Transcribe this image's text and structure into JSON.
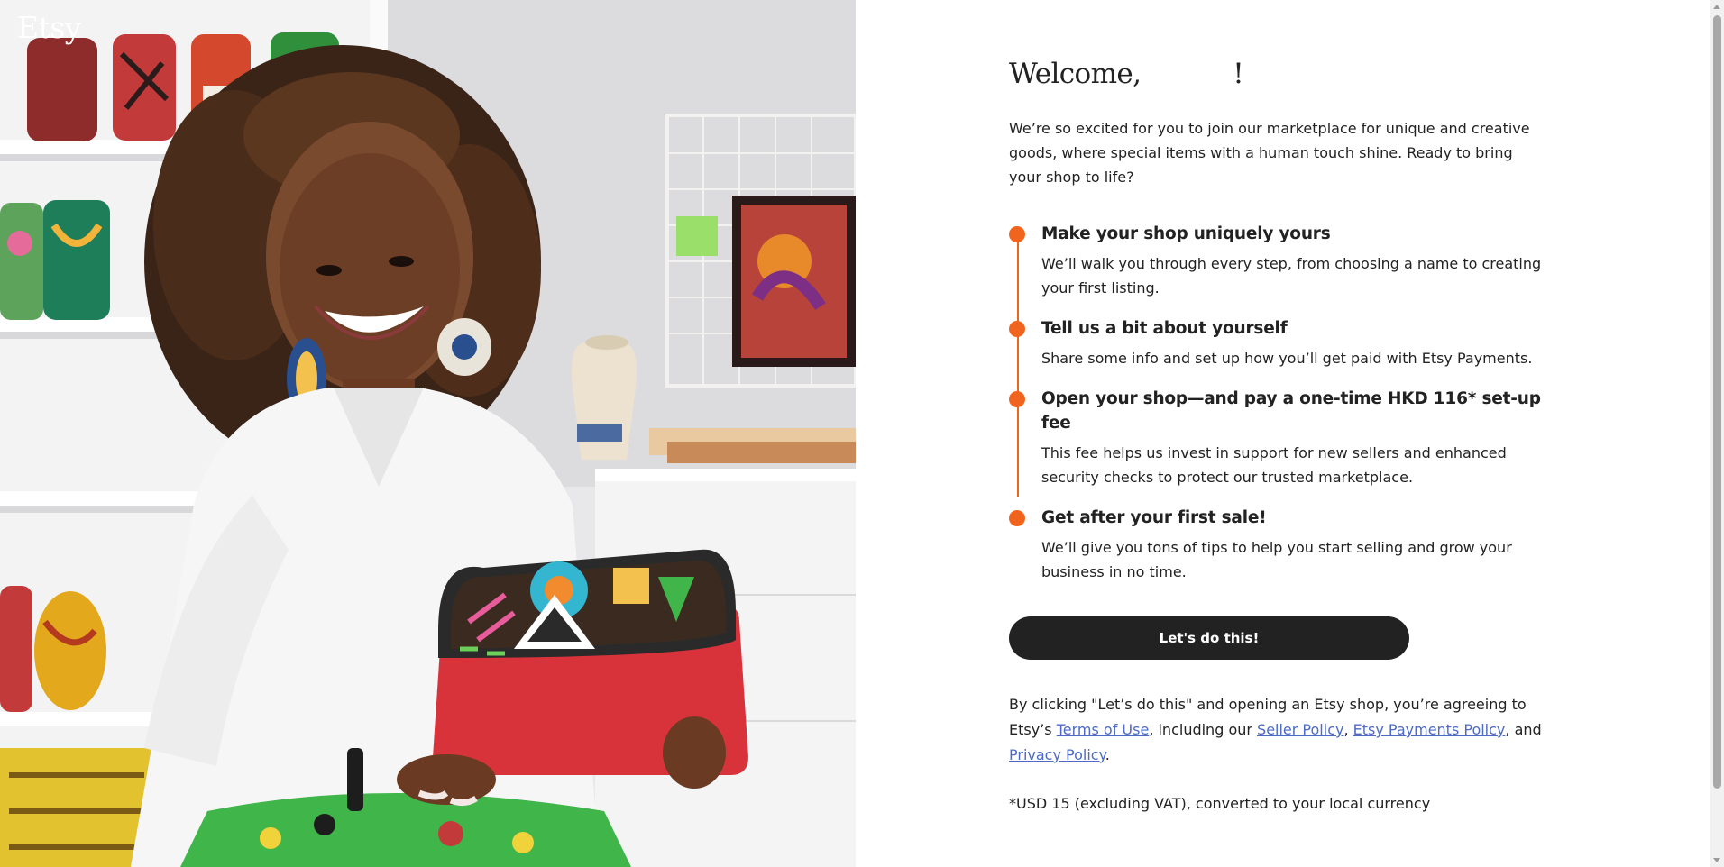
{
  "brand": {
    "logo_text": "Etsy",
    "accent": "#f1641e",
    "link_color": "#4d6bc6"
  },
  "photo": {
    "alt": "Seller smiling and holding a colourful patterned handbag in her studio"
  },
  "welcome": {
    "heading": "Welcome,           !"
  },
  "intro": "We’re so excited for you to join our marketplace for unique and creative goods, where special items with a human touch shine. Ready to bring your shop to life?",
  "steps": [
    {
      "title": "Make your shop uniquely yours",
      "desc": "We’ll walk you through every step, from choosing a name to creating your first listing."
    },
    {
      "title": "Tell us a bit about yourself",
      "desc": "Share some info and set up how you’ll get paid with Etsy Payments."
    },
    {
      "title": "Open your shop—and pay a one-time HKD 116* set-up fee",
      "desc": "This fee helps us invest in support for new sellers and enhanced security checks to protect our trusted marketplace."
    },
    {
      "title": "Get after your first sale!",
      "desc": "We’ll give you tons of tips to help you start selling and grow your business in no time."
    }
  ],
  "cta_label": "Let's do this!",
  "legal": {
    "part1": "By clicking \"Let’s do this\" and opening an Etsy shop, you’re agreeing to Etsy’s ",
    "terms": "Terms of Use",
    "part2": ",  including our ",
    "seller_policy": "Seller Policy",
    "sep": ", ",
    "payments_policy": "Etsy Payments Policy",
    "part3": ", and ",
    "privacy": "Privacy Policy",
    "end": "."
  },
  "footnote": "*USD 15 (excluding VAT), converted to your local currency"
}
